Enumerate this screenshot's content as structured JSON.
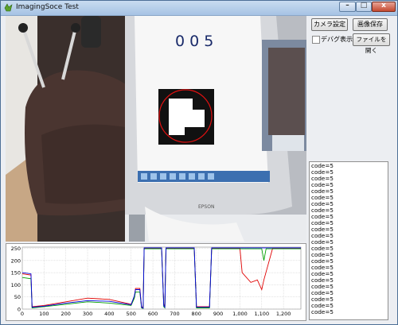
{
  "window": {
    "title": "ImagingSoce Test",
    "controls": {
      "minimize": "–",
      "maximize": "□",
      "close": "x"
    }
  },
  "camera_view": {
    "screen_text": "0 0 5",
    "monitor_brand": "EPSON"
  },
  "buttons": {
    "camera_settings": "カメラ設定",
    "save_image": "画像保存",
    "open_file": "ファイルを開く"
  },
  "debug_checkbox": {
    "label": "デバグ表示",
    "checked": false
  },
  "log_lines": [
    "code=5",
    "code=5",
    "code=5",
    "code=5",
    "code=5",
    "code=5",
    "code=5",
    "code=5",
    "code=5",
    "code=5",
    "code=5",
    "code=5",
    "code=5",
    "code=5",
    "code=5",
    "code=5",
    "code=5",
    "code=5",
    "code=5",
    "code=5",
    "code=5",
    "code=5",
    "code=5",
    "code=5"
  ],
  "chart_data": {
    "type": "line",
    "title": "",
    "xlabel": "",
    "ylabel": "",
    "xlim": [
      0,
      1280
    ],
    "ylim": [
      0,
      255
    ],
    "x_ticks": [
      "0",
      "100",
      "200",
      "300",
      "400",
      "500",
      "600",
      "700",
      "800",
      "900",
      "1,000",
      "1,100",
      "1,200"
    ],
    "y_ticks": [
      "250",
      "200",
      "150",
      "100",
      "50",
      "0"
    ],
    "grid": true,
    "series": [
      {
        "color": "#e00000",
        "values": [
          [
            0,
            145
          ],
          [
            40,
            140
          ],
          [
            45,
            10
          ],
          [
            100,
            15
          ],
          [
            200,
            30
          ],
          [
            300,
            45
          ],
          [
            400,
            40
          ],
          [
            500,
            20
          ],
          [
            515,
            50
          ],
          [
            520,
            85
          ],
          [
            540,
            85
          ],
          [
            548,
            10
          ],
          [
            555,
            5
          ],
          [
            560,
            250
          ],
          [
            630,
            250
          ],
          [
            640,
            250
          ],
          [
            650,
            20
          ],
          [
            655,
            10
          ],
          [
            660,
            250
          ],
          [
            700,
            250
          ],
          [
            790,
            250
          ],
          [
            800,
            10
          ],
          [
            860,
            10
          ],
          [
            870,
            250
          ],
          [
            900,
            250
          ],
          [
            1000,
            250
          ],
          [
            1010,
            150
          ],
          [
            1050,
            110
          ],
          [
            1080,
            120
          ],
          [
            1100,
            80
          ],
          [
            1110,
            120
          ],
          [
            1150,
            250
          ],
          [
            1250,
            250
          ],
          [
            1280,
            250
          ]
        ]
      },
      {
        "color": "#00a000",
        "values": [
          [
            0,
            130
          ],
          [
            40,
            125
          ],
          [
            45,
            5
          ],
          [
            100,
            10
          ],
          [
            200,
            20
          ],
          [
            300,
            30
          ],
          [
            400,
            25
          ],
          [
            500,
            15
          ],
          [
            515,
            45
          ],
          [
            520,
            70
          ],
          [
            540,
            70
          ],
          [
            548,
            5
          ],
          [
            555,
            3
          ],
          [
            560,
            248
          ],
          [
            630,
            248
          ],
          [
            640,
            248
          ],
          [
            650,
            10
          ],
          [
            655,
            5
          ],
          [
            660,
            248
          ],
          [
            700,
            248
          ],
          [
            790,
            248
          ],
          [
            800,
            5
          ],
          [
            860,
            5
          ],
          [
            870,
            248
          ],
          [
            900,
            248
          ],
          [
            1000,
            248
          ],
          [
            1050,
            248
          ],
          [
            1100,
            248
          ],
          [
            1110,
            200
          ],
          [
            1120,
            248
          ],
          [
            1250,
            248
          ],
          [
            1280,
            248
          ]
        ]
      },
      {
        "color": "#0000e0",
        "values": [
          [
            0,
            150
          ],
          [
            40,
            145
          ],
          [
            45,
            8
          ],
          [
            100,
            12
          ],
          [
            200,
            25
          ],
          [
            300,
            35
          ],
          [
            400,
            32
          ],
          [
            500,
            18
          ],
          [
            515,
            55
          ],
          [
            520,
            80
          ],
          [
            540,
            80
          ],
          [
            548,
            8
          ],
          [
            555,
            4
          ],
          [
            560,
            252
          ],
          [
            630,
            252
          ],
          [
            640,
            252
          ],
          [
            650,
            15
          ],
          [
            655,
            8
          ],
          [
            660,
            252
          ],
          [
            700,
            252
          ],
          [
            790,
            252
          ],
          [
            800,
            8
          ],
          [
            860,
            8
          ],
          [
            870,
            252
          ],
          [
            900,
            252
          ],
          [
            1000,
            252
          ],
          [
            1100,
            252
          ],
          [
            1250,
            252
          ],
          [
            1280,
            252
          ]
        ]
      }
    ]
  }
}
